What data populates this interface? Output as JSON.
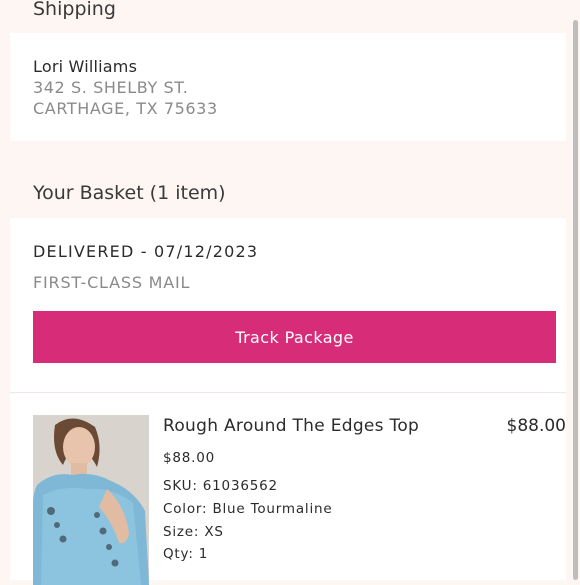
{
  "shipping": {
    "header": "Shipping",
    "name": "Lori Williams",
    "address_line1": "342 S. SHELBY ST.",
    "address_line2": "CARTHAGE, TX 75633"
  },
  "basket": {
    "header": "Your Basket (1 item)",
    "status": "DELIVERED - 07/12/2023",
    "shipping_method": "FIRST-CLASS MAIL",
    "track_label": "Track Package"
  },
  "product": {
    "title": "Rough Around The Edges Top",
    "price_right": "$88.00",
    "price": "$88.00",
    "sku": "SKU: 61036562",
    "color": "Color: Blue Tourmaline",
    "size": "Size: XS",
    "qty": "Qty: 1"
  },
  "colors": {
    "accent": "#d72d79",
    "background": "#fdf6f3",
    "card": "#ffffff"
  }
}
